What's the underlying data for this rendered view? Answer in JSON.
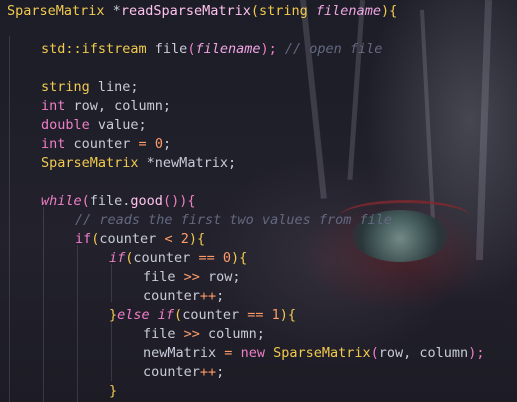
{
  "code": {
    "line1": {
      "type": "SparseMatrix",
      "ptr": " *",
      "fn": "readSparseMatrix",
      "open": "(",
      "ptype": "string",
      "sp": " ",
      "param": "filename",
      "close": "){"
    },
    "line2": {
      "ns": "std::",
      "type": "ifstream",
      "var": " file",
      "open": "(",
      "arg": "filename",
      "close": ");",
      "sp": " ",
      "comment": "// open file"
    },
    "line3": {
      "type": "string",
      "rest": " line;"
    },
    "line4": {
      "type": "int",
      "rest": " row, column;"
    },
    "line5": {
      "type": "double",
      "rest": " value;"
    },
    "line6": {
      "type": "int",
      "var": " counter ",
      "op": "=",
      "sp": " ",
      "num": "0",
      "end": ";"
    },
    "line7": {
      "type": "SparseMatrix",
      "rest": " *newMatrix;"
    },
    "line8": {
      "kw": "while",
      "open": "(",
      "obj": "file.",
      "fn": "good",
      "parens": "()",
      "close": "){"
    },
    "line9": {
      "comment": "// reads the first two values from file"
    },
    "line10": {
      "kw": "if",
      "open": "(",
      "var": "counter ",
      "op": "<",
      "sp": " ",
      "num": "2",
      "close": "){"
    },
    "line11": {
      "kw": "if",
      "open": "(",
      "var": "counter ",
      "op": "==",
      "sp": " ",
      "num": "0",
      "close": "){"
    },
    "line12": {
      "var": "file ",
      "op": ">>",
      "rest": " row;"
    },
    "line13": {
      "var": "counter",
      "op": "++",
      "end": ";"
    },
    "line14": {
      "brace": "}",
      "kw": "else if",
      "open": "(",
      "var": "counter ",
      "op": "==",
      "sp": " ",
      "num": "1",
      "close": "){"
    },
    "line15": {
      "var": "file ",
      "op": ">>",
      "rest": " column;"
    },
    "line16": {
      "var": "newMatrix ",
      "op": "=",
      "sp": " ",
      "kw": "new",
      "sp2": " ",
      "type": "SparseMatrix",
      "open": "(",
      "args": "row, column",
      "close": ");"
    },
    "line17": {
      "var": "counter",
      "op": "++",
      "end": ";"
    },
    "line18": {
      "brace": "}"
    }
  }
}
